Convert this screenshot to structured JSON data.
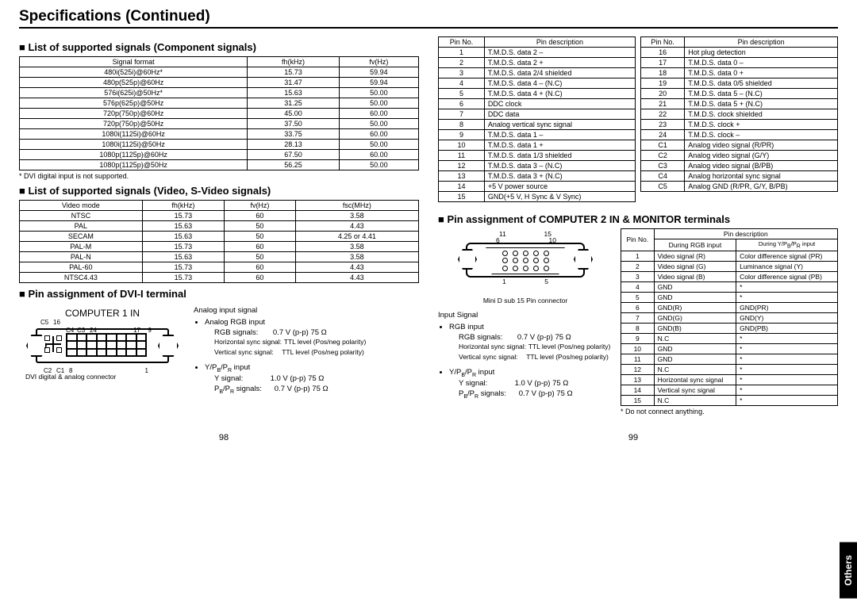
{
  "pageTitle": "Specifications (Continued)",
  "sideTab": "Others",
  "pageNumLeft": "98",
  "pageNumRight": "99",
  "sec1": {
    "heading": "List of supported signals (Component signals)",
    "headers": [
      "Signal format",
      "fh(kHz)",
      "fv(Hz)"
    ],
    "rows": [
      [
        "480i(525i)@60Hz*",
        "15.73",
        "59.94"
      ],
      [
        "480p(525p)@60Hz",
        "31.47",
        "59.94"
      ],
      [
        "576i(625i)@50Hz*",
        "15.63",
        "50.00"
      ],
      [
        "576p(625p)@50Hz",
        "31.25",
        "50.00"
      ],
      [
        "720p(750p)@60Hz",
        "45.00",
        "60.00"
      ],
      [
        "720p(750p)@50Hz",
        "37.50",
        "50.00"
      ],
      [
        "1080i(1125i)@60Hz",
        "33.75",
        "60.00"
      ],
      [
        "1080i(1125i)@50Hz",
        "28.13",
        "50.00"
      ],
      [
        "1080p(1125p)@60Hz",
        "67.50",
        "60.00"
      ],
      [
        "1080p(1125p)@50Hz",
        "56.25",
        "50.00"
      ]
    ],
    "note": "* DVI digital input is not supported."
  },
  "sec2": {
    "heading": "List of supported signals (Video, S-Video signals)",
    "headers": [
      "Video mode",
      "fh(kHz)",
      "fv(Hz)",
      "fsc(MHz)"
    ],
    "rows": [
      [
        "NTSC",
        "15.73",
        "60",
        "3.58"
      ],
      [
        "PAL",
        "15.63",
        "50",
        "4.43"
      ],
      [
        "SECAM",
        "15.63",
        "50",
        "4.25 or 4.41"
      ],
      [
        "PAL-M",
        "15.73",
        "60",
        "3.58"
      ],
      [
        "PAL-N",
        "15.63",
        "50",
        "3.58"
      ],
      [
        "PAL-60",
        "15.73",
        "60",
        "4.43"
      ],
      [
        "NTSC4.43",
        "15.73",
        "60",
        "4.43"
      ]
    ]
  },
  "sec3": {
    "heading": "Pin assignment of DVI-I terminal",
    "connectorLabel": "COMPUTER 1 IN",
    "subCaption": "DVI digital & analog connector",
    "pinTop": {
      "c5": "C5",
      "p16": "16",
      "c4": "C4",
      "c3": "C3",
      "p24": "24",
      "p17": "17",
      "p9": "9"
    },
    "pinBottom": {
      "c2": "C2",
      "c1": "C1",
      "p8": "8",
      "p1": "1"
    },
    "analog": {
      "title": "Analog input signal",
      "rgbTitle": "Analog RGB input",
      "rgbL1a": "RGB signals:",
      "rgbL1b": "0.7 V (p-p) 75 Ω",
      "rgbL2a": "Horizontal sync signal:",
      "rgbL2b": "TTL level (Pos/neg polarity)",
      "rgbL3a": "Vertical sync signal:",
      "rgbL3b": "TTL level (Pos/neg polarity)",
      "yTitle": "Y/PB/PR input",
      "yL1a": "Y signal:",
      "yL1b": "1.0 V (p-p) 75 Ω",
      "yL2a": "PB/PR signals:",
      "yL2b": "0.7 V (p-p) 75 Ω"
    },
    "tableA": {
      "headers": [
        "Pin No.",
        "Pin description"
      ],
      "rows": [
        [
          "1",
          "T.M.D.S. data 2 –"
        ],
        [
          "2",
          "T.M.D.S. data 2 +"
        ],
        [
          "3",
          "T.M.D.S. data 2/4 shielded"
        ],
        [
          "4",
          "T.M.D.S. data 4 – (N.C)"
        ],
        [
          "5",
          "T.M.D.S. data 4 + (N.C)"
        ],
        [
          "6",
          "DDC clock"
        ],
        [
          "7",
          "DDC data"
        ],
        [
          "8",
          "Analog vertical sync signal"
        ],
        [
          "9",
          "T.M.D.S. data 1 –"
        ],
        [
          "10",
          "T.M.D.S. data 1 +"
        ],
        [
          "11",
          "T.M.D.S. data 1/3 shielded"
        ],
        [
          "12",
          "T.M.D.S. data 3 – (N.C)"
        ],
        [
          "13",
          "T.M.D.S. data 3 + (N.C)"
        ],
        [
          "14",
          "+5 V power source"
        ],
        [
          "15",
          "GND(+5 V, H Sync & V Sync)"
        ]
      ]
    },
    "tableB": {
      "headers": [
        "Pin No.",
        "Pin description"
      ],
      "rows": [
        [
          "16",
          "Hot plug detection"
        ],
        [
          "17",
          "T.M.D.S. data 0 –"
        ],
        [
          "18",
          "T.M.D.S. data 0 +"
        ],
        [
          "19",
          "T.M.D.S. data 0/5 shielded"
        ],
        [
          "20",
          "T.M.D.S. data 5 – (N.C)"
        ],
        [
          "21",
          "T.M.D.S. data 5 + (N.C)"
        ],
        [
          "22",
          "T.M.D.S. clock shielded"
        ],
        [
          "23",
          "T.M.D.S. clock +"
        ],
        [
          "24",
          "T.M.D.S. clock –"
        ],
        [
          "C1",
          "Analog video signal (R/PR)"
        ],
        [
          "C2",
          "Analog video signal (G/Y)"
        ],
        [
          "C3",
          "Analog video signal (B/PB)"
        ],
        [
          "C4",
          "Analog horizontal sync signal"
        ],
        [
          "C5",
          "Analog GND (R/PR, G/Y, B/PB)"
        ]
      ]
    }
  },
  "sec4": {
    "heading": "Pin assignment of COMPUTER 2 IN & MONITOR terminals",
    "connCaption": "Mini D sub 15 Pin connector",
    "pinLabels": {
      "p11": "11",
      "p15": "15",
      "p6": "6",
      "p10": "10",
      "p1": "1",
      "p5": "5"
    },
    "inputSignalTitle": "Input Signal",
    "rgbTitle": "RGB input",
    "rgbL1a": "RGB signals:",
    "rgbL1b": "0.7 V (p-p) 75 Ω",
    "rgbL2a": "Horizontal sync signal:",
    "rgbL2b": "TTL level (Pos/neg polarity)",
    "rgbL3a": "Vertical sync signal:",
    "rgbL3b": "TTL level (Pos/neg polarity)",
    "yTitle": "Y/PB/PR input",
    "yL1a": "Y signal:",
    "yL1b": "1.0 V (p-p) 75 Ω",
    "yL2a": "PB/PR signals:",
    "yL2b": "0.7 V (p-p) 75 Ω",
    "table": {
      "hdrTop": [
        "Pin No.",
        "Pin description"
      ],
      "hdrSub": [
        "During RGB input",
        "During Y/PB/PR input"
      ],
      "rows": [
        [
          "1",
          "Video signal (R)",
          "Color difference signal (PR)"
        ],
        [
          "2",
          "Video signal (G)",
          "Luminance signal (Y)"
        ],
        [
          "3",
          "Video signal (B)",
          "Color difference signal (PB)"
        ],
        [
          "4",
          "GND",
          "*"
        ],
        [
          "5",
          "GND",
          "*"
        ],
        [
          "6",
          "GND(R)",
          "GND(PR)"
        ],
        [
          "7",
          "GND(G)",
          "GND(Y)"
        ],
        [
          "8",
          "GND(B)",
          "GND(PB)"
        ],
        [
          "9",
          "N.C",
          "*"
        ],
        [
          "10",
          "GND",
          "*"
        ],
        [
          "11",
          "GND",
          "*"
        ],
        [
          "12",
          "N.C",
          "*"
        ],
        [
          "13",
          "Horizontal sync signal",
          "*"
        ],
        [
          "14",
          "Vertical sync signal",
          "*"
        ],
        [
          "15",
          "N.C",
          "*"
        ]
      ],
      "note": "* Do not connect anything."
    }
  }
}
